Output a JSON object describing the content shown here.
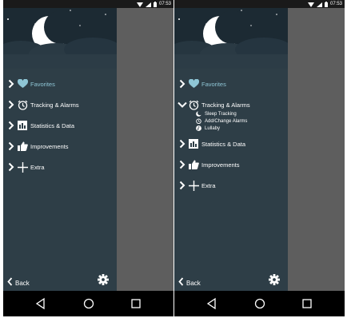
{
  "status_time": "07:53",
  "left_panel": {
    "menu": [
      {
        "label": "Favorites",
        "icon": "heart-icon",
        "highlighted": true
      },
      {
        "label": "Tracking & Alarms",
        "icon": "alarm-clock-icon"
      },
      {
        "label": "Statistics & Data",
        "icon": "bar-chart-icon"
      },
      {
        "label": "Improvements",
        "icon": "thumbs-up-icon"
      },
      {
        "label": "Extra",
        "icon": "plus-icon"
      }
    ]
  },
  "right_panel": {
    "menu": [
      {
        "label": "Favorites",
        "icon": "heart-icon",
        "highlighted": true
      },
      {
        "label": "Tracking & Alarms",
        "icon": "alarm-clock-icon",
        "expanded": true,
        "children": [
          {
            "label": "Sleep Tracking",
            "icon": "moon-icon"
          },
          {
            "label": "Add/Change Alarms",
            "icon": "alarm-clock-icon"
          },
          {
            "label": "Lullaby",
            "icon": "music-note-icon"
          }
        ]
      },
      {
        "label": "Statistics & Data",
        "icon": "bar-chart-icon"
      },
      {
        "label": "Improvements",
        "icon": "thumbs-up-icon"
      },
      {
        "label": "Extra",
        "icon": "plus-icon"
      }
    ]
  },
  "footer": {
    "back_label": "Back"
  },
  "colors": {
    "drawer_bg": "#2e3e47",
    "header_bg": "#1c2a33",
    "accent": "#8fc6d6",
    "text": "#ffffff",
    "dimmed_content": "#5e5e5e",
    "navbar": "#000000"
  }
}
